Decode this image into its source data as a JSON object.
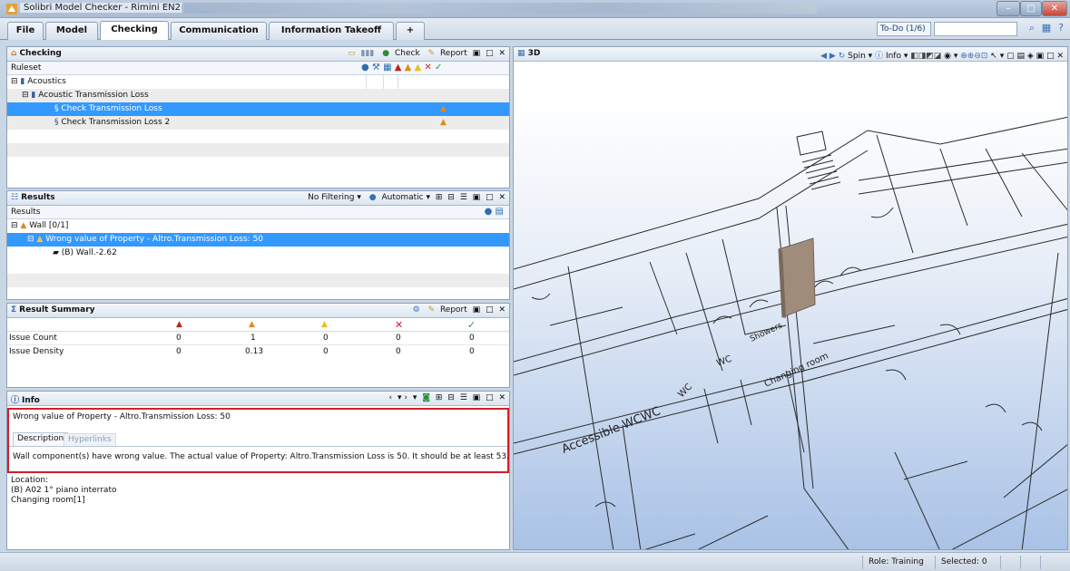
{
  "window": {
    "title": "Solibri Model Checker - Rimini EN2"
  },
  "menu_tabs": [
    "File",
    "Model",
    "Checking",
    "Communication",
    "Information Takeoff",
    "+"
  ],
  "todo_label": "To-Do (1/6)",
  "checking": {
    "title": "Checking",
    "check_label": "Check",
    "report_label": "Report",
    "column_ruleset": "Ruleset",
    "rows": [
      {
        "label": "Acoustics"
      },
      {
        "label": "Acoustic Transmission Loss"
      },
      {
        "label": "Check Transmission Loss"
      },
      {
        "label": "Check Transmission Loss 2"
      }
    ]
  },
  "results": {
    "title": "Results",
    "filter_label": "No Filtering",
    "automatic_label": "Automatic",
    "column_results": "Results",
    "rows": [
      {
        "label": "Wall [0/1]"
      },
      {
        "label": "Wrong value of Property - Altro.Transmission Loss: 50"
      },
      {
        "label": "(B) Wall.-2.62"
      }
    ]
  },
  "summary": {
    "title": "Result Summary",
    "report_label": "Report",
    "rows": [
      {
        "label": "Issue Count",
        "values": [
          "0",
          "1",
          "0",
          "0",
          "0"
        ]
      },
      {
        "label": "Issue Density",
        "values": [
          "0",
          "0.13",
          "0",
          "0",
          "0"
        ]
      }
    ]
  },
  "info": {
    "title": "Info",
    "headline": "Wrong value of Property - Altro.Transmission Loss: 50",
    "tab_description": "Description",
    "tab_hyperlinks": "Hyperlinks",
    "description": "Wall component(s) have wrong value. The actual value of Property: Altro.Transmission Loss is 50. It should be at least 53.",
    "location_label": "Location:",
    "location_line1": "(B) A02 1° piano interrato",
    "location_line2": "Changing room[1]"
  },
  "view3d": {
    "title": "3D",
    "spin_label": "Spin",
    "info_label": "Info",
    "room_labels": [
      "Accessible WCWC",
      "WC",
      "WC",
      "Showers",
      "Changing room"
    ]
  },
  "status": {
    "role": "Role: Training",
    "selected": "Selected: 0"
  },
  "colors": {
    "selection": "#3399ff",
    "highlight_border": "#d0202a",
    "accent": "#1a3f7a"
  }
}
